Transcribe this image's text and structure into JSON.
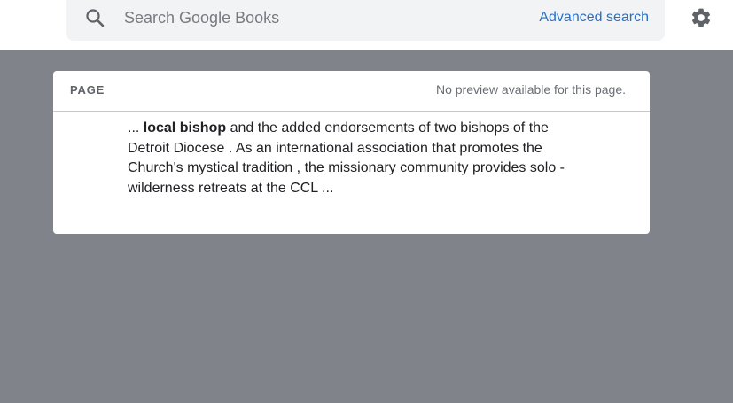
{
  "search": {
    "placeholder": "Search Google Books",
    "advanced_label": "Advanced search"
  },
  "icons": {
    "search": "search-icon",
    "settings": "gear-icon"
  },
  "result": {
    "section_label": "PAGE",
    "preview_status": "No preview available for this page.",
    "snippet_prefix": "... ",
    "snippet_highlight": "local bishop",
    "snippet_rest": " and the added endorsements of two bishops of the Detroit Diocese . As an international association that promotes the Church's mystical tradition , the missionary community provides solo - wilderness retreats at the CCL ..."
  },
  "colors": {
    "page_background": "#80838a",
    "link": "#2a6fc4"
  }
}
